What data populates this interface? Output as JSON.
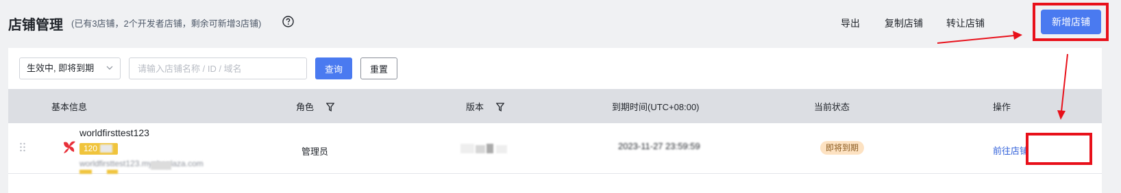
{
  "header": {
    "title": "店铺管理",
    "subtitle": "(已有3店铺，2个开发者店铺，剩余可新增3店铺)",
    "export_label": "导出",
    "copy_store_label": "复制店铺",
    "transfer_store_label": "转让店铺",
    "add_store_label": "新增店铺"
  },
  "filters": {
    "status_select": "生效中, 即将到期",
    "search_placeholder": "请输入店铺名称 / ID / 域名",
    "query_label": "查询",
    "reset_label": "重置"
  },
  "table": {
    "columns": {
      "basic_info": "基本信息",
      "role": "角色",
      "version": "版本",
      "expiry": "到期时间(UTC+08:00)",
      "status": "当前状态",
      "actions": "操作"
    },
    "rows": [
      {
        "store_name": "worldfirsttest123",
        "store_id": "120",
        "domain": "worldfirsttest123.myshoplaza.com",
        "role": "管理员",
        "expiry": "2023-11-27 23:59:59",
        "status": "即将到期",
        "action": "前往店铺"
      }
    ]
  },
  "colors": {
    "primary": "#4a7af0",
    "annotation_red": "#e8101a",
    "status_badge_bg": "#fde2c2",
    "link": "#2f5fd9"
  }
}
